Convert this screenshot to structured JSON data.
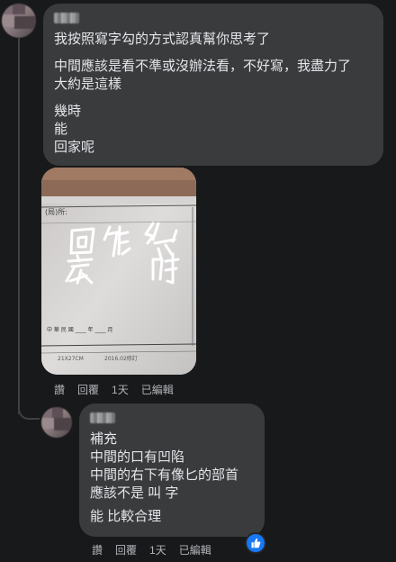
{
  "comment1": {
    "lines_p1": [
      "我按照寫字勾的方式認真幫你思考了"
    ],
    "lines_p2": [
      "中間應該是看不準或沒辦法看，不好寫，我盡力了",
      "大約是這樣"
    ],
    "lines_p3": [
      "幾時",
      "能",
      "回家呢"
    ]
  },
  "photo": {
    "form_header": "(局)所:",
    "handwriting": [
      "回",
      "能",
      "幾",
      "家",
      "時"
    ],
    "footer_text": "中 華 民 國 ____ 年 ____ 月",
    "size_label": "21X27CM",
    "date_label": "2016.02修訂"
  },
  "actions1": {
    "like": "讚",
    "reply": "回覆",
    "time": "1天",
    "edited": "已編輯"
  },
  "comment2": {
    "lines": [
      "補充",
      "中間的口有凹陷",
      "中間的右下有像匕的部首",
      "應該不是 叫 字"
    ],
    "final": "能 比較合理"
  },
  "actions2": {
    "like": "讚",
    "reply": "回覆",
    "time": "1天",
    "edited": "已編輯"
  },
  "reaction": {
    "icon": "thumbs-up-icon",
    "color": "#1877f2"
  }
}
